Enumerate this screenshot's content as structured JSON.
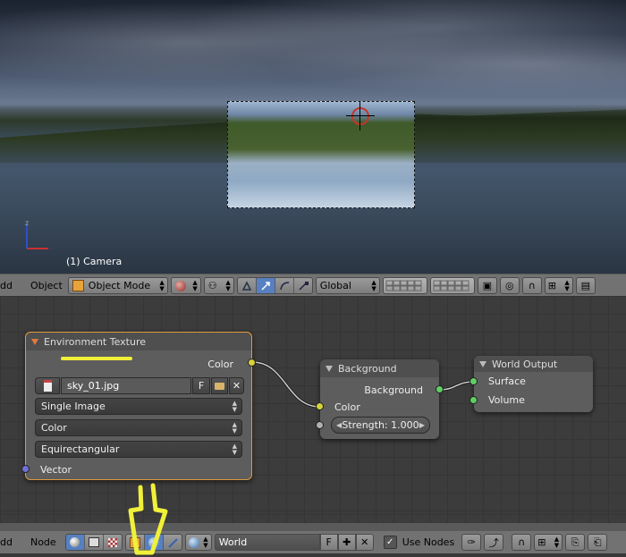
{
  "viewport": {
    "camera_label": "(1) Camera",
    "axis_z": "z"
  },
  "view3d_header": {
    "menu_add": "dd",
    "menu_object": "Object",
    "mode_select": "Object Mode",
    "orientation_select": "Global"
  },
  "node_editor": {
    "env_texture": {
      "title": "Environment Texture",
      "output_color": "Color",
      "image_name": "sky_01.jpg",
      "fake_user": "F",
      "source_select": "Single Image",
      "color_space_select": "Color",
      "projection_select": "Equirectangular",
      "input_vector": "Vector"
    },
    "background": {
      "title": "Background",
      "output_background": "Background",
      "input_color": "Color",
      "strength_label": "Strength:",
      "strength_value": "1.000"
    },
    "world_output": {
      "title": "World Output",
      "input_surface": "Surface",
      "input_volume": "Volume"
    }
  },
  "node_header": {
    "menu_add": "dd",
    "menu_node": "Node",
    "world_name": "World",
    "fake_user": "F",
    "use_nodes_label": "Use Nodes",
    "use_nodes_checked": true
  },
  "colors": {
    "highlight": "#f0f03a",
    "selected_node_border": "#e09a3e",
    "socket_color": "#d8d23a",
    "socket_shader": "#5fcf62",
    "socket_vector": "#7070d8"
  }
}
